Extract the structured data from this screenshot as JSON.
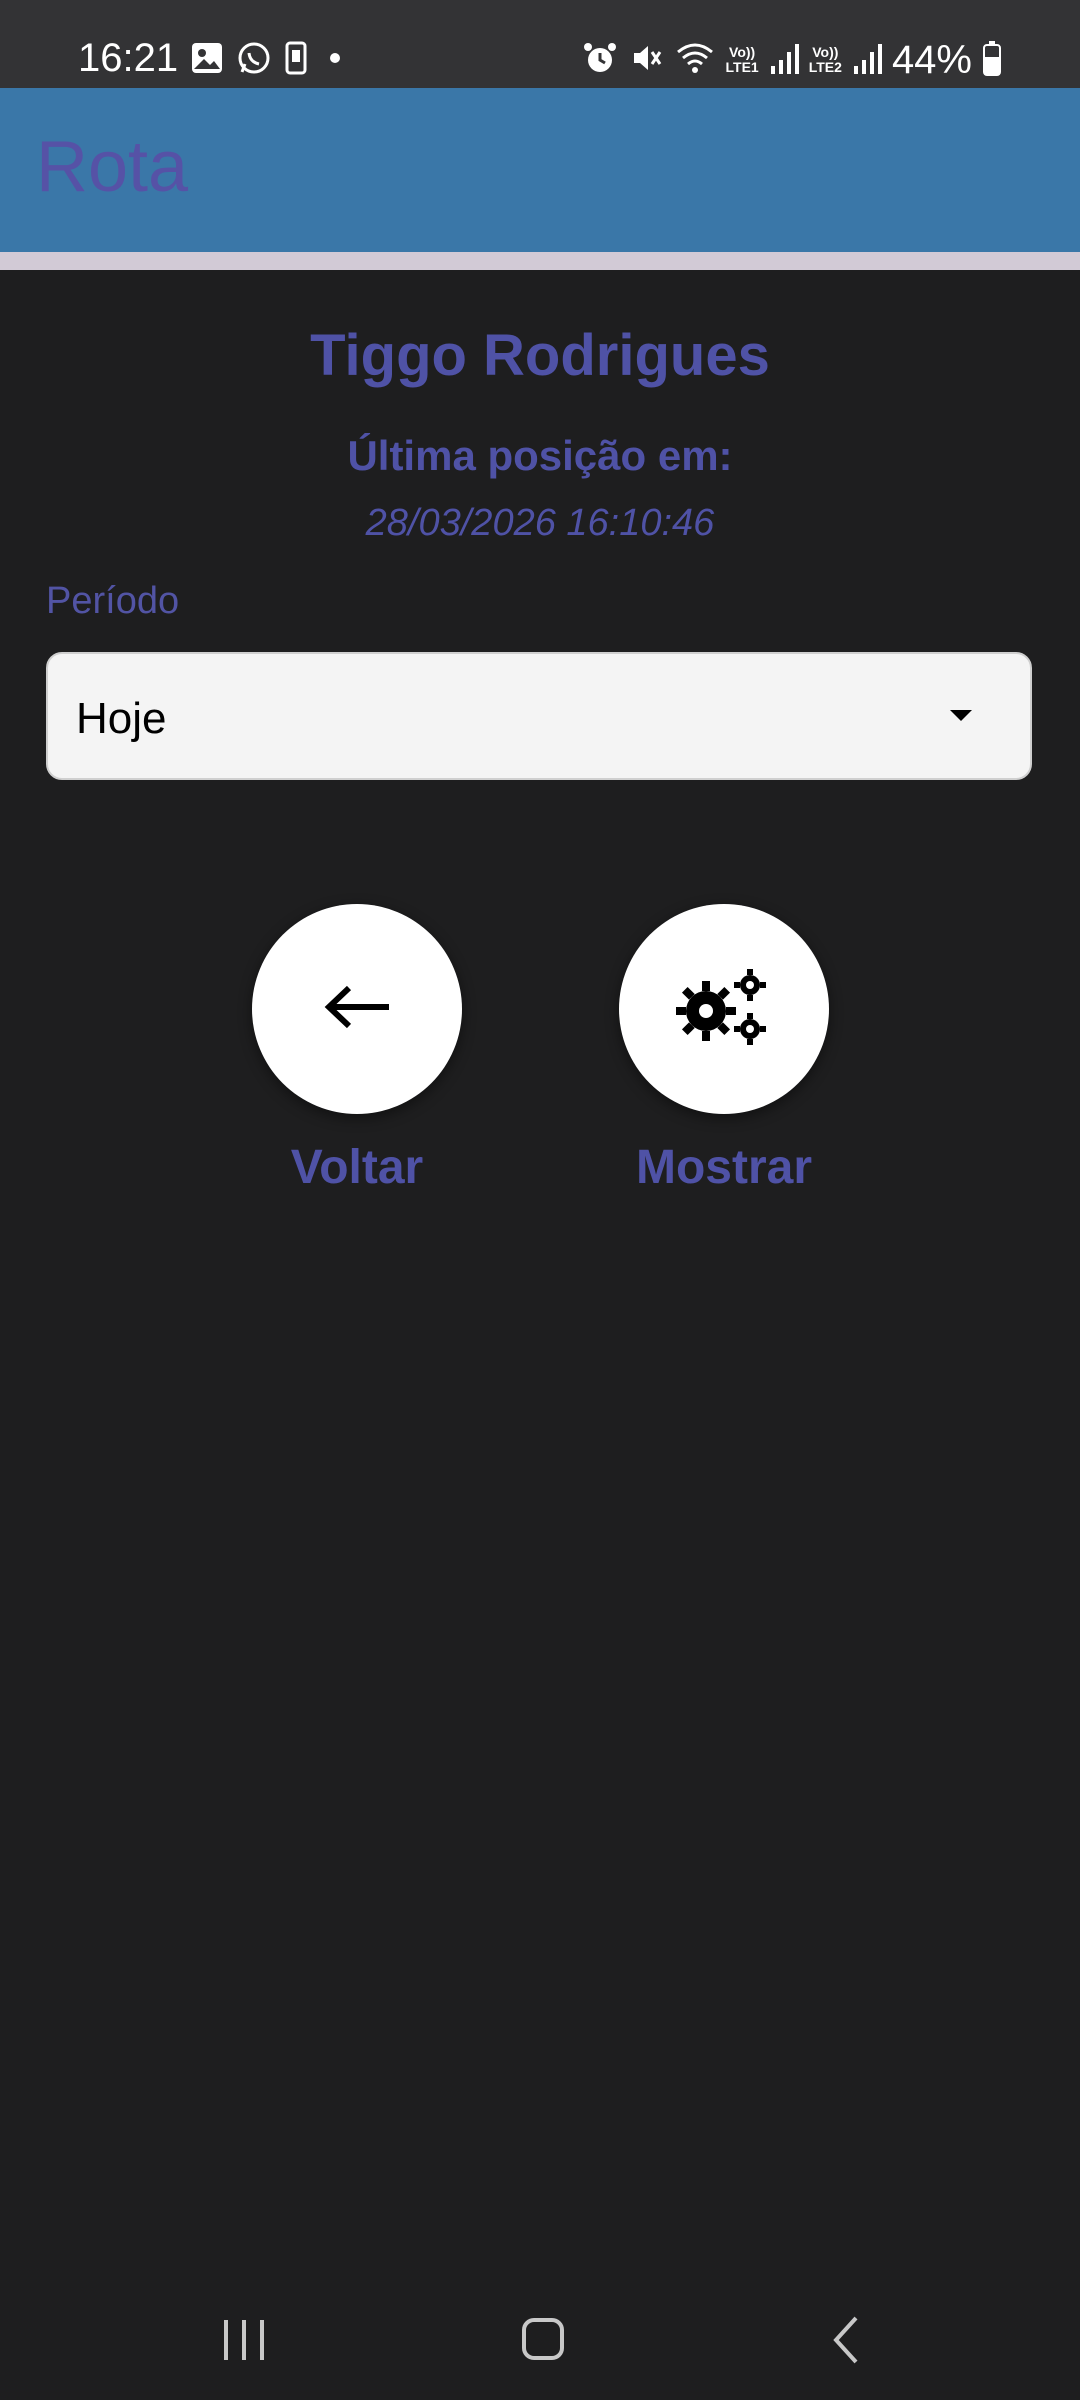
{
  "status_bar": {
    "time": "16:21",
    "battery": "44%",
    "sim1": [
      "Vo))",
      "LTE1"
    ],
    "sim2": [
      "Vo))",
      "LTE2"
    ],
    "left_icons": [
      "gallery-icon",
      "whatsapp-icon",
      "phone-icon",
      "dot-icon"
    ],
    "right_icons": [
      "alarm-icon",
      "mute-icon",
      "wifi-icon",
      "signal-icon",
      "battery-icon"
    ]
  },
  "appbar": {
    "title": "Rota"
  },
  "header": {
    "name": "Tiggo Rodrigues",
    "last_position_label": "Última posição em:",
    "last_position_time": "28/03/2026 16:10:46"
  },
  "period": {
    "label": "Período",
    "selected": "Hoje"
  },
  "actions": {
    "back_label": "Voltar",
    "show_label": "Mostrar"
  },
  "colors": {
    "accent": "#4f52a6",
    "appbar": "#3a77a8",
    "background": "#1e1e1f"
  }
}
